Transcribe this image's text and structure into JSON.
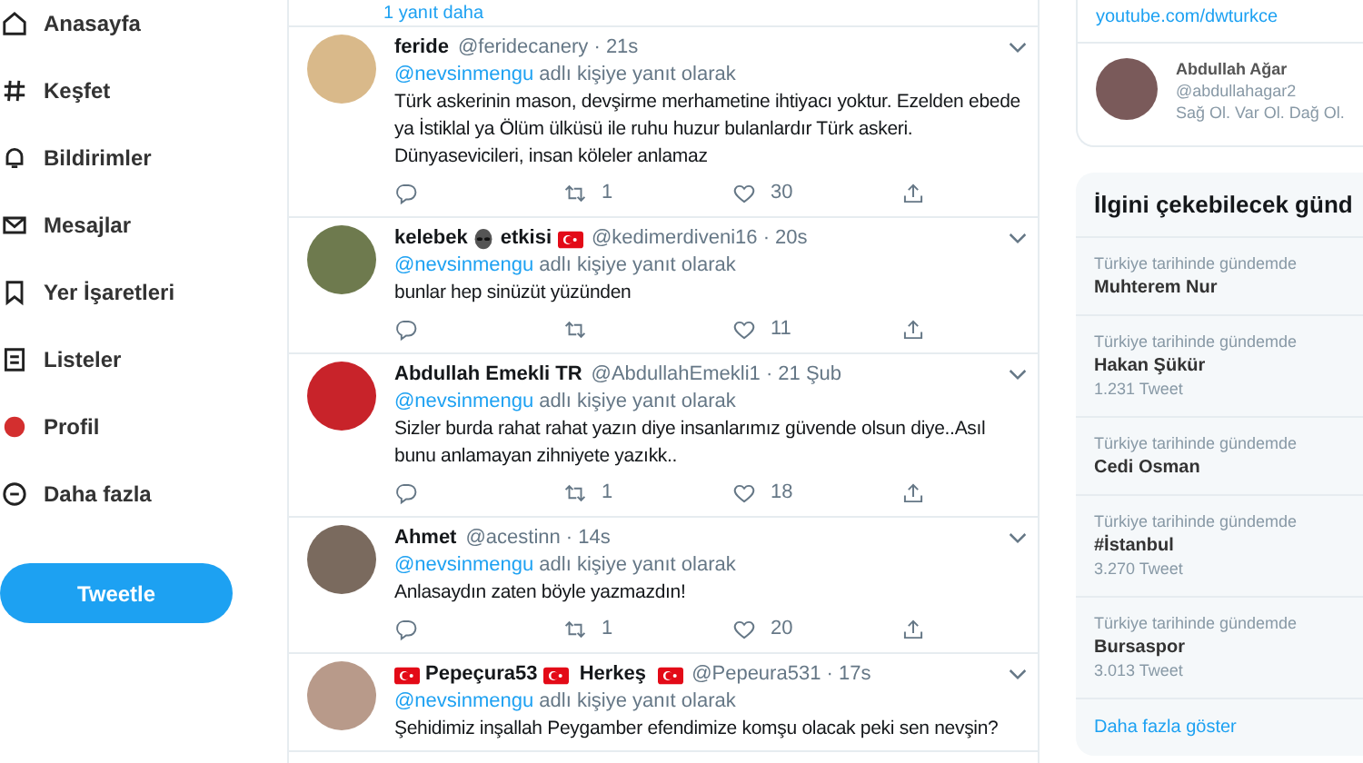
{
  "sidebar": {
    "items": [
      {
        "label": "Anasayfa"
      },
      {
        "label": "Keşfet"
      },
      {
        "label": "Bildirimler"
      },
      {
        "label": "Mesajlar"
      },
      {
        "label": "Yer İşaretleri"
      },
      {
        "label": "Listeler"
      },
      {
        "label": "Profil"
      },
      {
        "label": "Daha fazla"
      }
    ],
    "tweet_button": "Tweetle"
  },
  "timeline": {
    "more_replies": "1 yanıt daha",
    "tweets": [
      {
        "name_parts": [
          {
            "kind": "text",
            "text": "feride"
          }
        ],
        "handle_time": "@feridecanery · 21s",
        "reply_to": "@nevsinmengu",
        "reply_suffix": "adlı kişiye yanıt olarak",
        "text": "Türk askerinin mason, devşirme merhametine ihtiyacı yoktur. Ezelden ebede ya İstiklal ya Ölüm ülküsü ile ruhu huzur bulanlardır Türk askeri. Dünyasevicileri, insan köleler anlamaz",
        "actions": {
          "retweets": "1",
          "likes": "30"
        }
      },
      {
        "name_parts": [
          {
            "kind": "text",
            "text": "kelebek"
          },
          {
            "kind": "alien"
          },
          {
            "kind": "text",
            "text": "etkisi"
          },
          {
            "kind": "flag"
          }
        ],
        "handle_time": "@kedimerdiveni16 · 20s",
        "reply_to": "@nevsinmengu",
        "reply_suffix": "adlı kişiye yanıt olarak",
        "text": "bunlar hep sinüzüt yüzünden",
        "actions": {
          "likes": "11"
        }
      },
      {
        "name_parts": [
          {
            "kind": "text",
            "text": "Abdullah Emekli TR"
          }
        ],
        "handle_time": "@AbdullahEmekli1 · 21 Şub",
        "reply_to": "@nevsinmengu",
        "reply_suffix": "adlı kişiye yanıt olarak",
        "text": "Sizler burda rahat rahat yazın diye insanlarımız güvende olsun diye..Asıl bunu anlamayan zihniyete yazıkk..",
        "actions": {
          "retweets": "1",
          "likes": "18"
        }
      },
      {
        "name_parts": [
          {
            "kind": "text",
            "text": "Ahmet"
          }
        ],
        "handle_time": "@acestinn · 14s",
        "reply_to": "@nevsinmengu",
        "reply_suffix": "adlı kişiye yanıt olarak",
        "text": "Anlasaydın zaten böyle yazmazdın!",
        "actions": {
          "retweets": "1",
          "likes": "20"
        }
      },
      {
        "name_parts": [
          {
            "kind": "flag"
          },
          {
            "kind": "text",
            "text": "Pepeçura53"
          },
          {
            "kind": "flag"
          },
          {
            "kind": "text",
            "text": " Herkeş "
          },
          {
            "kind": "flag"
          }
        ],
        "handle_time": "@Pepeura531 · 17s",
        "reply_to": "@nevsinmengu",
        "reply_suffix": "adlı kişiye yanıt olarak",
        "text": "Şehidimiz inşallah Peygamber efendimize komşu olacak peki sen nevşin?"
      }
    ]
  },
  "right": {
    "link": "youtube.com/dwturkce",
    "profile": {
      "name": "Abdullah Ağar",
      "handle": "@abdullahagar2",
      "bio": "Sağ Ol. Var Ol. Dağ Ol."
    },
    "trends_title": "İlgini çekebilecek günd",
    "trends": [
      {
        "context": "Türkiye tarihinde gündemde",
        "name": "Muhterem Nur"
      },
      {
        "context": "Türkiye tarihinde gündemde",
        "name": "Hakan Şükür",
        "count": "1.231 Tweet"
      },
      {
        "context": "Türkiye tarihinde gündemde",
        "name": "Cedi Osman"
      },
      {
        "context": "Türkiye tarihinde gündemde",
        "name": "#İstanbul",
        "count": "3.270 Tweet"
      },
      {
        "context": "Türkiye tarihinde gündemde",
        "name": "Bursaspor",
        "count": "3.013 Tweet"
      }
    ],
    "show_more": "Daha fazla göster"
  }
}
